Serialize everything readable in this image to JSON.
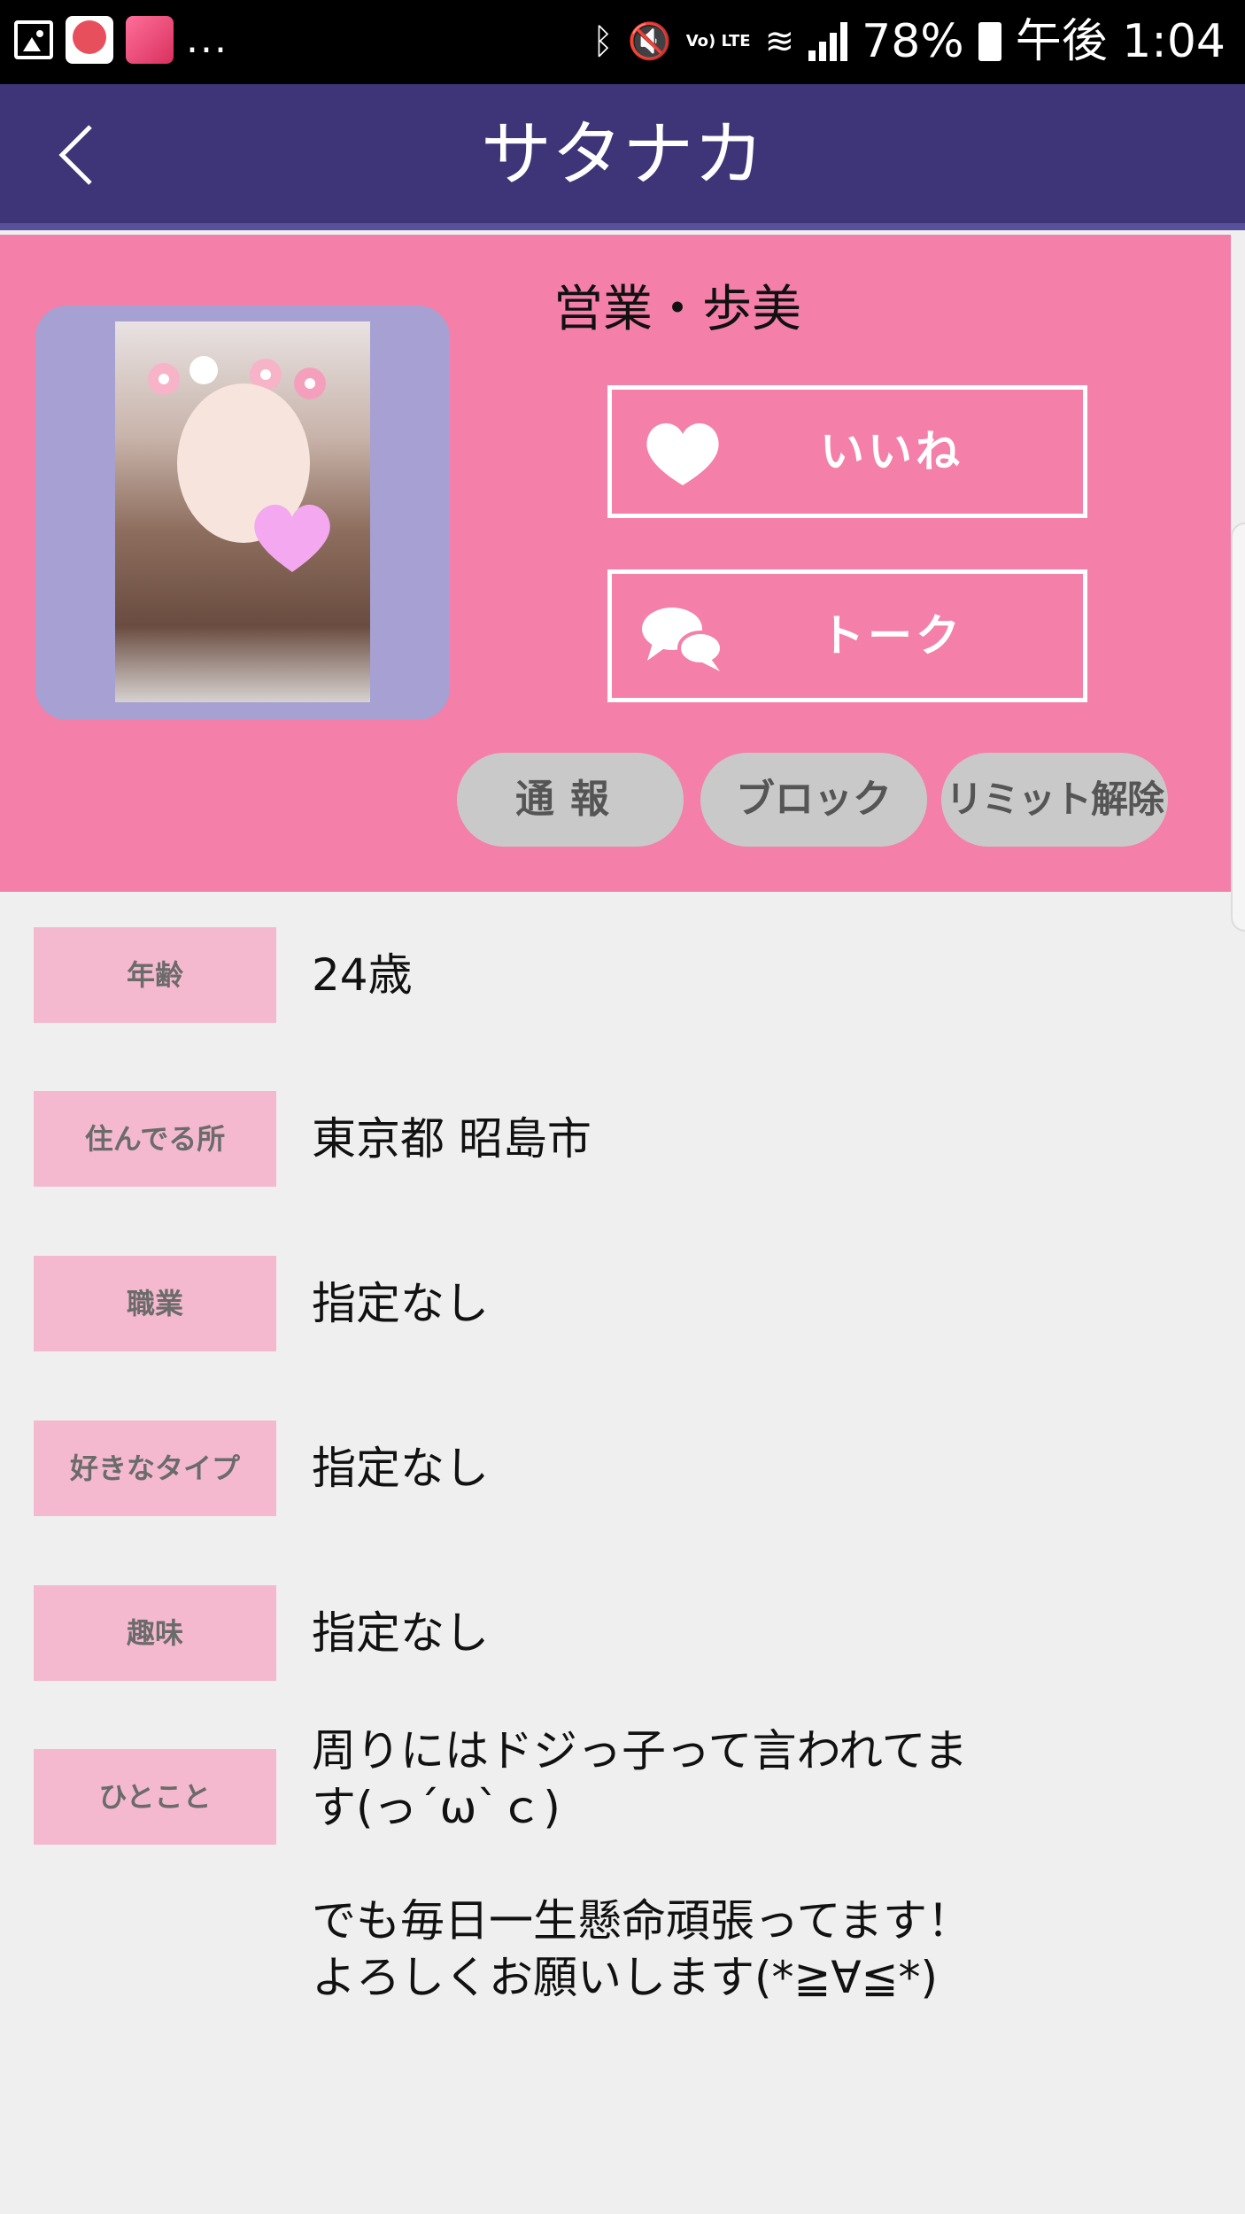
{
  "status_bar": {
    "more_indicator": "...",
    "battery": "78%",
    "time": "午後 1:04",
    "lte_label": "Vo) LTE",
    "icons": [
      "gallery-icon",
      "app-notification-icon",
      "app-notification-icon",
      "bluetooth-icon",
      "mute-icon",
      "lte-icon",
      "wifi-icon",
      "signal-icon",
      "battery-icon"
    ]
  },
  "nav": {
    "title": "サタナカ",
    "back_icon": "chevron-left-icon"
  },
  "profile": {
    "name": "営業・歩美",
    "like_label": "いいね",
    "talk_label": "トーク",
    "report_label": "通報",
    "block_label": "ブロック",
    "limit_label": "リミット解除"
  },
  "details": [
    {
      "label": "年齢",
      "value": "24歳"
    },
    {
      "label": "住んでる所",
      "value": "東京都 昭島市"
    },
    {
      "label": "職業",
      "value": "指定なし"
    },
    {
      "label": "好きなタイプ",
      "value": "指定なし"
    },
    {
      "label": "趣味",
      "value": "指定なし"
    }
  ],
  "message": {
    "label": "ひとこと",
    "line1": "周りにはドジっ子って言われてま",
    "line2": "す(っ´ω`ｃ)",
    "line3": "でも毎日一生懸命頑張ってます！",
    "line4": "よろしくお願いします(*≧∀≦*)"
  },
  "colors": {
    "navbar": "#3d3577",
    "profile_bg": "#f47fa9",
    "photo_frame": "#a6a0d3",
    "label_bg": "#f5b9cf",
    "pill_bg": "#c9c9c9",
    "page_bg": "#efefef"
  }
}
